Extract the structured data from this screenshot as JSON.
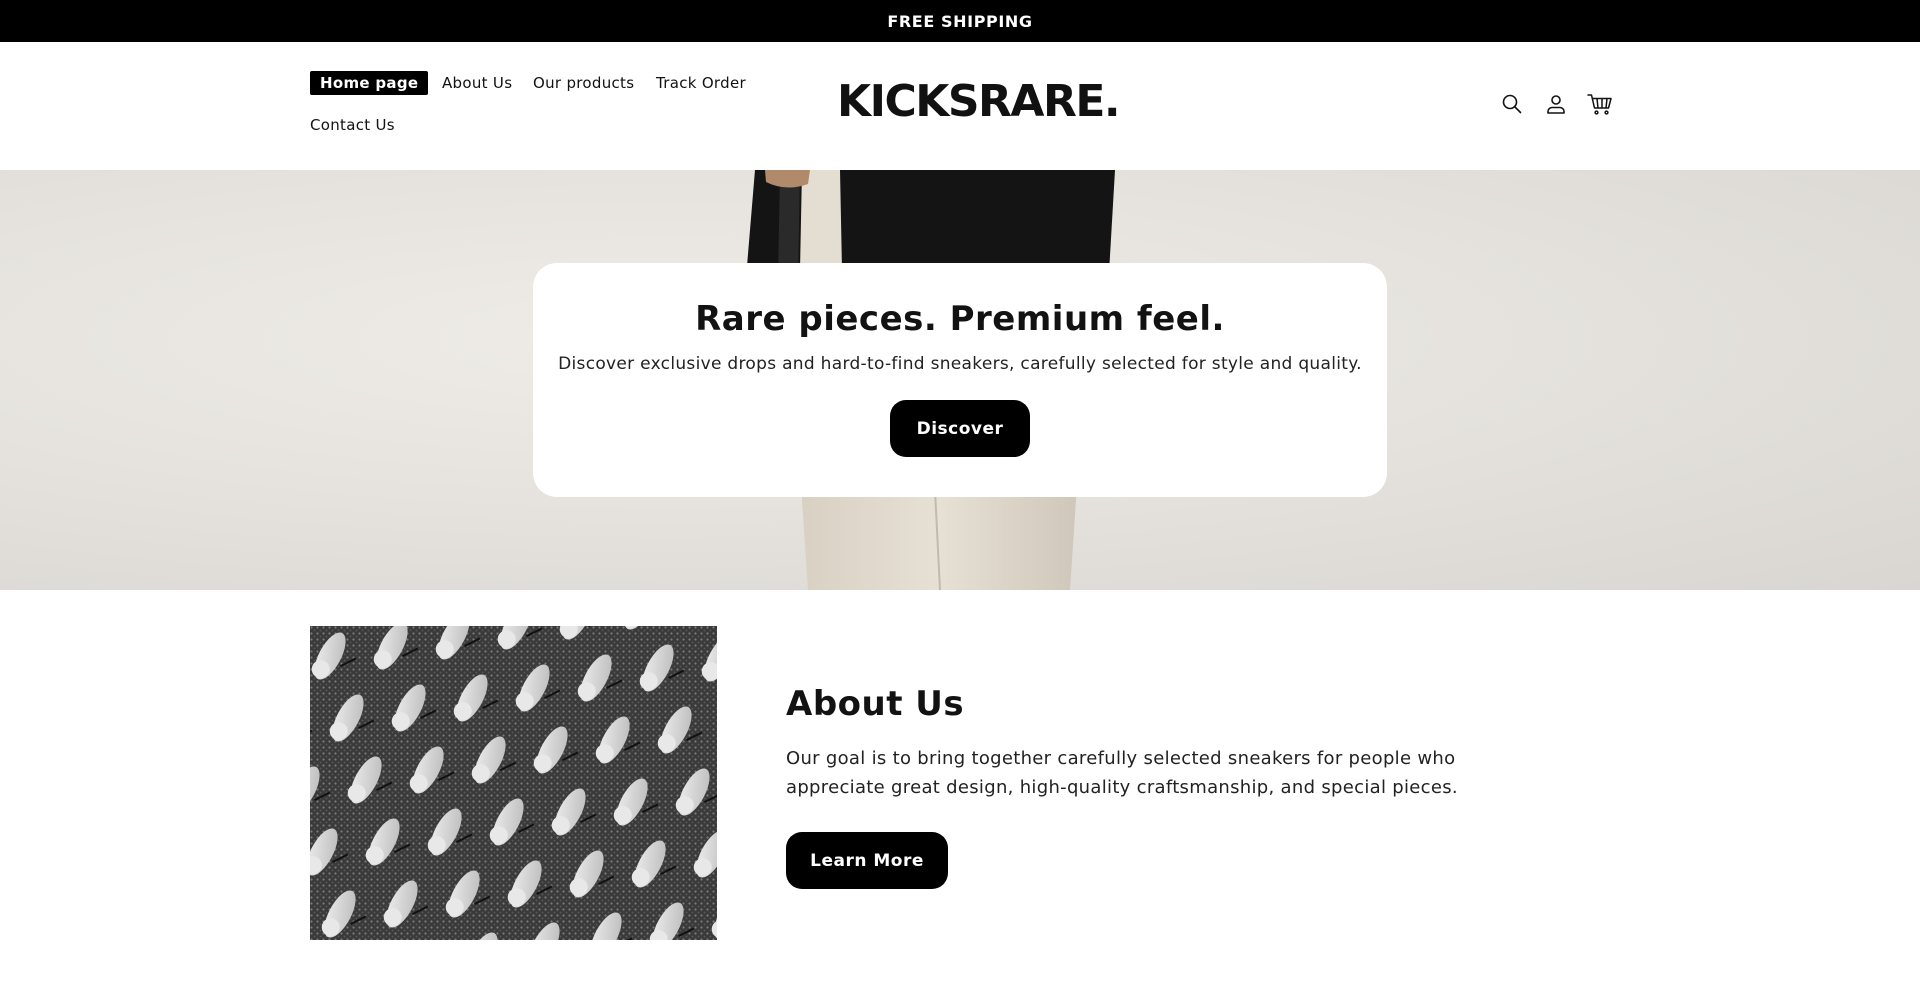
{
  "announcement": {
    "text": "FREE SHIPPING"
  },
  "header": {
    "nav": [
      {
        "label": "Home page",
        "active": true
      },
      {
        "label": "About Us",
        "active": false
      },
      {
        "label": "Our products",
        "active": false
      },
      {
        "label": "Track Order",
        "active": false
      },
      {
        "label": "Contact Us",
        "active": false
      }
    ],
    "logo": "KICKSRARE.",
    "icons": [
      "search-icon",
      "account-icon",
      "cart-icon"
    ]
  },
  "hero": {
    "title": "Rare pieces. Premium feel.",
    "subtitle": "Discover exclusive drops and hard-to-find sneakers, carefully selected for style and quality.",
    "button_label": "Discover"
  },
  "about": {
    "title": "About Us",
    "text": "Our goal is to bring together carefully selected sneakers for people who appreciate great design, high-quality craftsmanship, and special pieces.",
    "button_label": "Learn More"
  },
  "colors": {
    "accent": "#000000",
    "background": "#ffffff",
    "text": "#121212",
    "hero_bg": "#e6e3de"
  }
}
